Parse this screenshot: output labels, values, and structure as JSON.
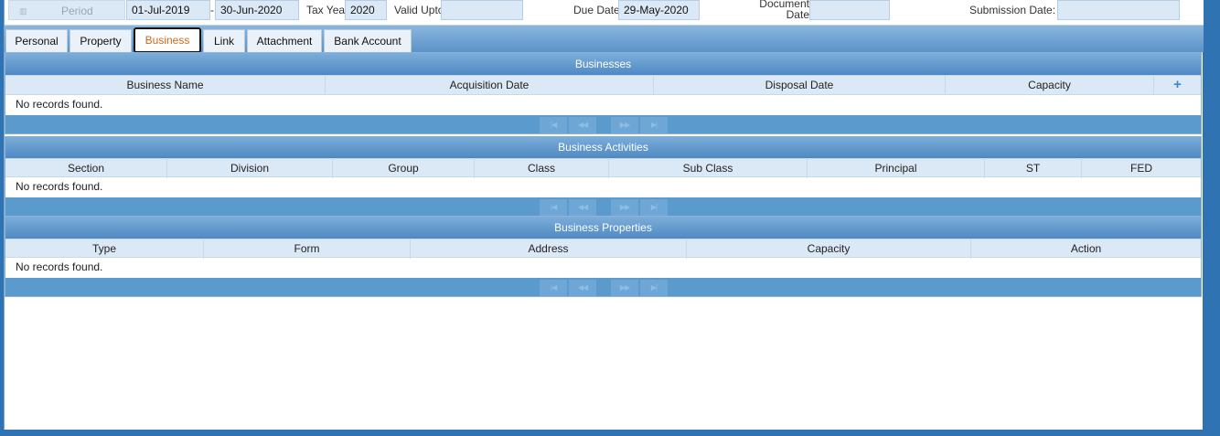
{
  "header": {
    "period_label": "Period",
    "period_from": "01-Jul-2019",
    "period_sep": "-",
    "period_to": "30-Jun-2020",
    "tax_year_label": "Tax Year",
    "tax_year": "2020",
    "valid_upto_label": "Valid Upto",
    "valid_upto": "",
    "due_date_label": "Due Date",
    "due_date": "29-May-2020",
    "document_label_1": "Document",
    "document_label_2": "Date",
    "document_date": "",
    "submission_label": "Submission Date: *",
    "submission_date": ""
  },
  "tabs": [
    {
      "label": "Personal"
    },
    {
      "label": "Property"
    },
    {
      "label": "Business"
    },
    {
      "label": "Link"
    },
    {
      "label": "Attachment"
    },
    {
      "label": "Bank Account"
    }
  ],
  "businesses": {
    "title": "Businesses",
    "columns": [
      "Business Name",
      "Acquisition Date",
      "Disposal Date",
      "Capacity",
      "+"
    ],
    "empty": "No records found."
  },
  "activities": {
    "title": "Business Activities",
    "columns": [
      "Section",
      "Division",
      "Group",
      "Class",
      "Sub Class",
      "Principal",
      "ST",
      "FED"
    ],
    "empty": "No records found."
  },
  "properties": {
    "title": "Business Properties",
    "columns": [
      "Type",
      "Form",
      "Address",
      "Capacity",
      "Action"
    ],
    "empty": "No records found."
  },
  "pager": {
    "first": "|◀",
    "prev": "◀◀",
    "next": "▶▶",
    "last": "▶|"
  }
}
